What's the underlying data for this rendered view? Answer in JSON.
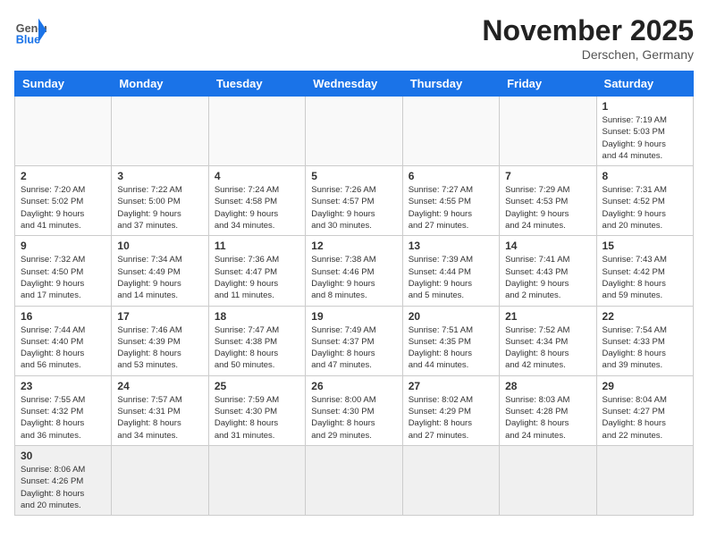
{
  "header": {
    "logo_general": "General",
    "logo_blue": "Blue",
    "month": "November 2025",
    "location": "Derschen, Germany"
  },
  "weekdays": [
    "Sunday",
    "Monday",
    "Tuesday",
    "Wednesday",
    "Thursday",
    "Friday",
    "Saturday"
  ],
  "days": [
    {
      "date": "",
      "info": ""
    },
    {
      "date": "",
      "info": ""
    },
    {
      "date": "",
      "info": ""
    },
    {
      "date": "",
      "info": ""
    },
    {
      "date": "",
      "info": ""
    },
    {
      "date": "",
      "info": ""
    },
    {
      "date": "1",
      "info": "Sunrise: 7:19 AM\nSunset: 5:03 PM\nDaylight: 9 hours\nand 44 minutes."
    },
    {
      "date": "2",
      "info": "Sunrise: 7:20 AM\nSunset: 5:02 PM\nDaylight: 9 hours\nand 41 minutes."
    },
    {
      "date": "3",
      "info": "Sunrise: 7:22 AM\nSunset: 5:00 PM\nDaylight: 9 hours\nand 37 minutes."
    },
    {
      "date": "4",
      "info": "Sunrise: 7:24 AM\nSunset: 4:58 PM\nDaylight: 9 hours\nand 34 minutes."
    },
    {
      "date": "5",
      "info": "Sunrise: 7:26 AM\nSunset: 4:57 PM\nDaylight: 9 hours\nand 30 minutes."
    },
    {
      "date": "6",
      "info": "Sunrise: 7:27 AM\nSunset: 4:55 PM\nDaylight: 9 hours\nand 27 minutes."
    },
    {
      "date": "7",
      "info": "Sunrise: 7:29 AM\nSunset: 4:53 PM\nDaylight: 9 hours\nand 24 minutes."
    },
    {
      "date": "8",
      "info": "Sunrise: 7:31 AM\nSunset: 4:52 PM\nDaylight: 9 hours\nand 20 minutes."
    },
    {
      "date": "9",
      "info": "Sunrise: 7:32 AM\nSunset: 4:50 PM\nDaylight: 9 hours\nand 17 minutes."
    },
    {
      "date": "10",
      "info": "Sunrise: 7:34 AM\nSunset: 4:49 PM\nDaylight: 9 hours\nand 14 minutes."
    },
    {
      "date": "11",
      "info": "Sunrise: 7:36 AM\nSunset: 4:47 PM\nDaylight: 9 hours\nand 11 minutes."
    },
    {
      "date": "12",
      "info": "Sunrise: 7:38 AM\nSunset: 4:46 PM\nDaylight: 9 hours\nand 8 minutes."
    },
    {
      "date": "13",
      "info": "Sunrise: 7:39 AM\nSunset: 4:44 PM\nDaylight: 9 hours\nand 5 minutes."
    },
    {
      "date": "14",
      "info": "Sunrise: 7:41 AM\nSunset: 4:43 PM\nDaylight: 9 hours\nand 2 minutes."
    },
    {
      "date": "15",
      "info": "Sunrise: 7:43 AM\nSunset: 4:42 PM\nDaylight: 8 hours\nand 59 minutes."
    },
    {
      "date": "16",
      "info": "Sunrise: 7:44 AM\nSunset: 4:40 PM\nDaylight: 8 hours\nand 56 minutes."
    },
    {
      "date": "17",
      "info": "Sunrise: 7:46 AM\nSunset: 4:39 PM\nDaylight: 8 hours\nand 53 minutes."
    },
    {
      "date": "18",
      "info": "Sunrise: 7:47 AM\nSunset: 4:38 PM\nDaylight: 8 hours\nand 50 minutes."
    },
    {
      "date": "19",
      "info": "Sunrise: 7:49 AM\nSunset: 4:37 PM\nDaylight: 8 hours\nand 47 minutes."
    },
    {
      "date": "20",
      "info": "Sunrise: 7:51 AM\nSunset: 4:35 PM\nDaylight: 8 hours\nand 44 minutes."
    },
    {
      "date": "21",
      "info": "Sunrise: 7:52 AM\nSunset: 4:34 PM\nDaylight: 8 hours\nand 42 minutes."
    },
    {
      "date": "22",
      "info": "Sunrise: 7:54 AM\nSunset: 4:33 PM\nDaylight: 8 hours\nand 39 minutes."
    },
    {
      "date": "23",
      "info": "Sunrise: 7:55 AM\nSunset: 4:32 PM\nDaylight: 8 hours\nand 36 minutes."
    },
    {
      "date": "24",
      "info": "Sunrise: 7:57 AM\nSunset: 4:31 PM\nDaylight: 8 hours\nand 34 minutes."
    },
    {
      "date": "25",
      "info": "Sunrise: 7:59 AM\nSunset: 4:30 PM\nDaylight: 8 hours\nand 31 minutes."
    },
    {
      "date": "26",
      "info": "Sunrise: 8:00 AM\nSunset: 4:30 PM\nDaylight: 8 hours\nand 29 minutes."
    },
    {
      "date": "27",
      "info": "Sunrise: 8:02 AM\nSunset: 4:29 PM\nDaylight: 8 hours\nand 27 minutes."
    },
    {
      "date": "28",
      "info": "Sunrise: 8:03 AM\nSunset: 4:28 PM\nDaylight: 8 hours\nand 24 minutes."
    },
    {
      "date": "29",
      "info": "Sunrise: 8:04 AM\nSunset: 4:27 PM\nDaylight: 8 hours\nand 22 minutes."
    },
    {
      "date": "30",
      "info": "Sunrise: 8:06 AM\nSunset: 4:26 PM\nDaylight: 8 hours\nand 20 minutes."
    },
    {
      "date": "",
      "info": ""
    },
    {
      "date": "",
      "info": ""
    },
    {
      "date": "",
      "info": ""
    },
    {
      "date": "",
      "info": ""
    },
    {
      "date": "",
      "info": ""
    },
    {
      "date": "",
      "info": ""
    }
  ]
}
